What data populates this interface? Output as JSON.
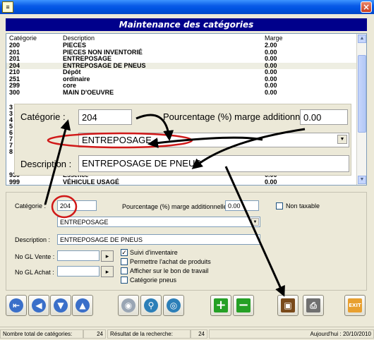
{
  "window": {
    "icon_glyph": "≡",
    "close_glyph": "×"
  },
  "header": {
    "title": "Maintenance des catégories"
  },
  "grid": {
    "columns": [
      "Catégorie",
      "Description",
      "Marge"
    ],
    "rows": [
      {
        "cat": "200",
        "desc": "PIECES",
        "marge": "2.00"
      },
      {
        "cat": "201",
        "desc": "PIECES NON INVENTORIÉ",
        "marge": "0.00"
      },
      {
        "cat": "201",
        "desc": "ENTREPOSAGE",
        "marge": "0.00"
      },
      {
        "cat": "204",
        "desc": "ENTREPOSAGE DE PNEUS",
        "marge": "0.00"
      },
      {
        "cat": "210",
        "desc": "Dépôt",
        "marge": "0.00"
      },
      {
        "cat": "251",
        "desc": "ordinaire",
        "marge": "0.00"
      },
      {
        "cat": "299",
        "desc": "core",
        "marge": "0.00"
      },
      {
        "cat": "300",
        "desc": "MAIN D'OEUVRE",
        "marge": "0.00"
      }
    ],
    "hidden_left_numbers": [
      "3",
      "3",
      "4",
      "5",
      "6",
      "7",
      "7",
      "8"
    ],
    "bottom_rows": [
      {
        "cat": "930",
        "desc": "Essence",
        "marge": "0.00"
      },
      {
        "cat": "999",
        "desc": "VÉHICULE USAGÉ",
        "marge": "0.00"
      }
    ]
  },
  "zoom": {
    "categorie_label": "Catégorie :",
    "categorie_value": "204",
    "pourcentage_label": "Pourcentage (%) marge additionnelle :",
    "pourcentage_value": "0.00",
    "combo_value": "ENTREPOSAGE",
    "description_label": "Description :",
    "description_value": "ENTREPOSAGE DE PNEUS"
  },
  "form": {
    "categorie_label": "Catégorie :",
    "categorie_value": "204",
    "pourcentage_label": "Pourcentage (%) marge additionnelle :",
    "pourcentage_value": "0.00",
    "non_taxable_label": "Non taxable",
    "combo_value": "ENTREPOSAGE",
    "description_label": "Description :",
    "description_value": "ENTREPOSAGE DE PNEUS",
    "gl_vente_label": "No GL Vente :",
    "gl_achat_label": "No GL Achat :",
    "chk_suivi": "Suivi d'inventaire",
    "chk_permettre": "Permettre l'achat de produits",
    "chk_afficher": "Afficher sur le bon de travail",
    "chk_pneus": "Catégorie pneus"
  },
  "status": {
    "total_label": "Nombre total de catégories:",
    "total_value": "24",
    "result_label": "Résultat de la recherche:",
    "result_value": "24",
    "date": "Aujourd'hui : 20/10/2010"
  },
  "toolbar": {
    "exit_label": "EXIT"
  },
  "colors": {
    "header_bg": "#00008b",
    "annotation_red": "#d01818",
    "annotation_black": "#000000"
  }
}
